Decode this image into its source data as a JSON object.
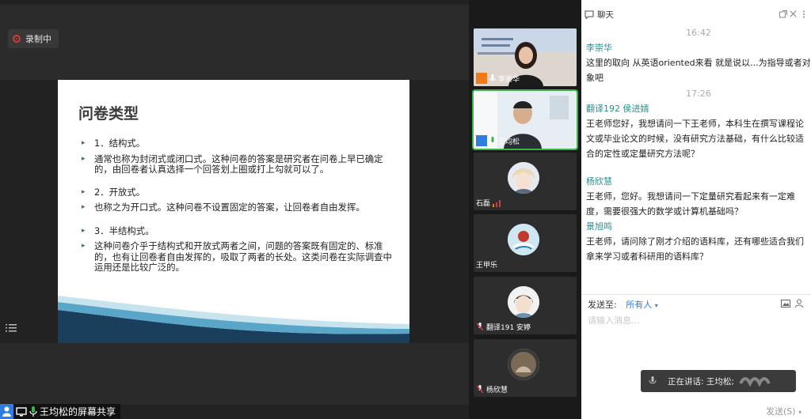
{
  "recording": {
    "label": "录制中"
  },
  "slide": {
    "title": "问卷类型",
    "items": [
      "1．结构式。",
      "通常也称为封闭式或闭口式。这种问卷的答案是研究者在问卷上早已确定的，由回卷者认真选择一个回答划上圈或打上勾就可以了。",
      "2．开放式。",
      "也称之为开口式。这种问卷不设置固定的答案，让回卷者自由发挥。",
      "3．半结构式。",
      "这种问卷介乎于结构式和开放式两者之间，问题的答案既有固定的、标准的，也有让回卷者自由发挥的，吸取了两者的长处。这类问卷在实际调查中运用还是比较广泛的。"
    ]
  },
  "share_label": "王均松的屏幕共享",
  "participants": [
    {
      "name": "李崇华"
    },
    {
      "name": "王均松"
    },
    {
      "name": "石磊"
    },
    {
      "name": "王甲乐"
    },
    {
      "name": "翻译191 安婷"
    },
    {
      "name": "杨欣慧"
    }
  ],
  "chat": {
    "title": "聊天",
    "messages": [
      {
        "time": "16:42",
        "sender": "李崇华",
        "text": "这里的取向 从英语oriented来看 就是说以...为指导或者对象吧"
      },
      {
        "time": "17:26",
        "sender": "翻译192 侯进婧",
        "text": "王老师您好，我想请问一下王老师，本科生在撰写课程论文或毕业论文的时候，没有研究方法基础，有什么比较适合的定性或定量研究方法呢？"
      },
      {
        "time": "",
        "sender": "杨欣慧",
        "text": "王老师，您好。我想请问一下定量研究看起来有一定难度，需要很强大的数学或计算机基础吗？"
      },
      {
        "time": "",
        "sender": "景旭鸣",
        "text": "王老师，请问除了刚才介绍的语料库，还有哪些适合我们拿来学习或者科研用的语料库？"
      }
    ],
    "send_to_label": "发送至:",
    "send_to_value": "所有人",
    "input_placeholder": "请输入消息...",
    "send_button": "发送(S)"
  },
  "speaking": {
    "label": "正在讲话: 王均松;"
  },
  "colors": {
    "accent": "#2f7de1",
    "active": "#3cb34a",
    "sender": "#2d8a8a",
    "rec": "#d23b3b"
  }
}
